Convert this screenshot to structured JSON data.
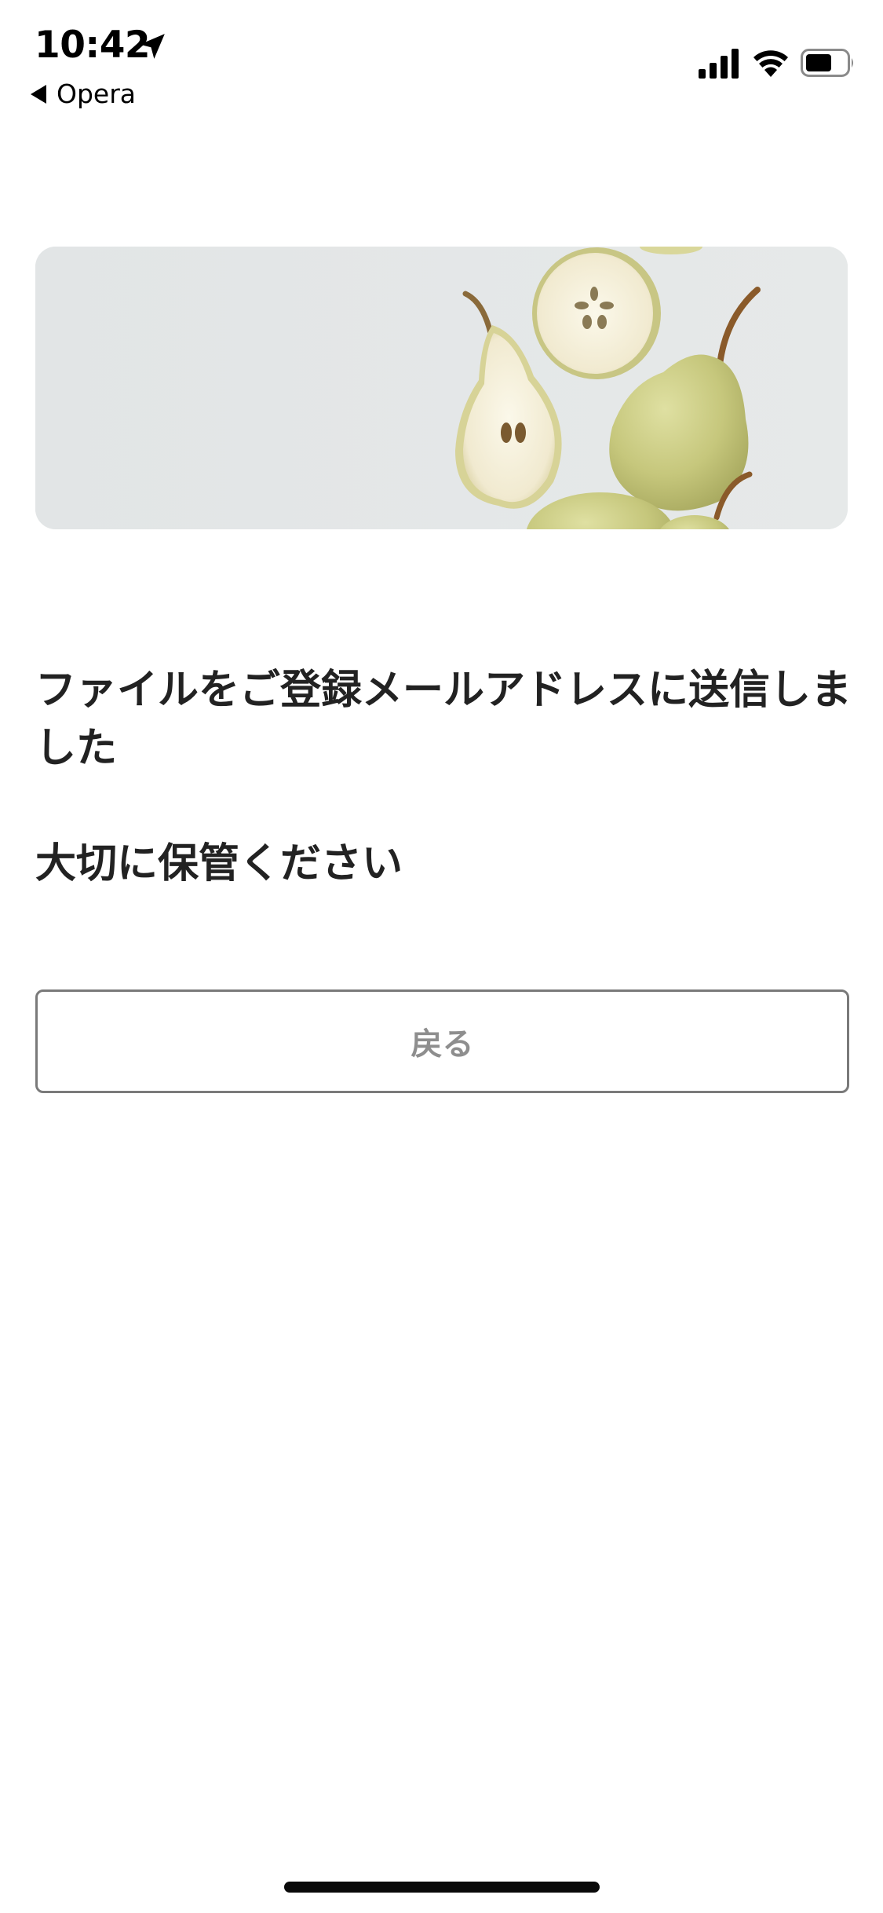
{
  "status_bar": {
    "time": "10:42",
    "back_app": "Opera",
    "icons": [
      "location-arrow-icon",
      "back-triangle-icon",
      "cellular-signal-icon",
      "wifi-icon",
      "battery-icon"
    ]
  },
  "hero": {
    "image": "pear-halves-photo"
  },
  "message": {
    "line1": "ファイルをご登録メールアドレスに送信しました",
    "line2": "大切に保管ください"
  },
  "back_button": {
    "label": "戻る"
  },
  "colors": {
    "text": "#222222",
    "button_border": "#7a7a7a",
    "button_text": "#8e8e8e",
    "hero_bg": "#e3e6e7"
  }
}
